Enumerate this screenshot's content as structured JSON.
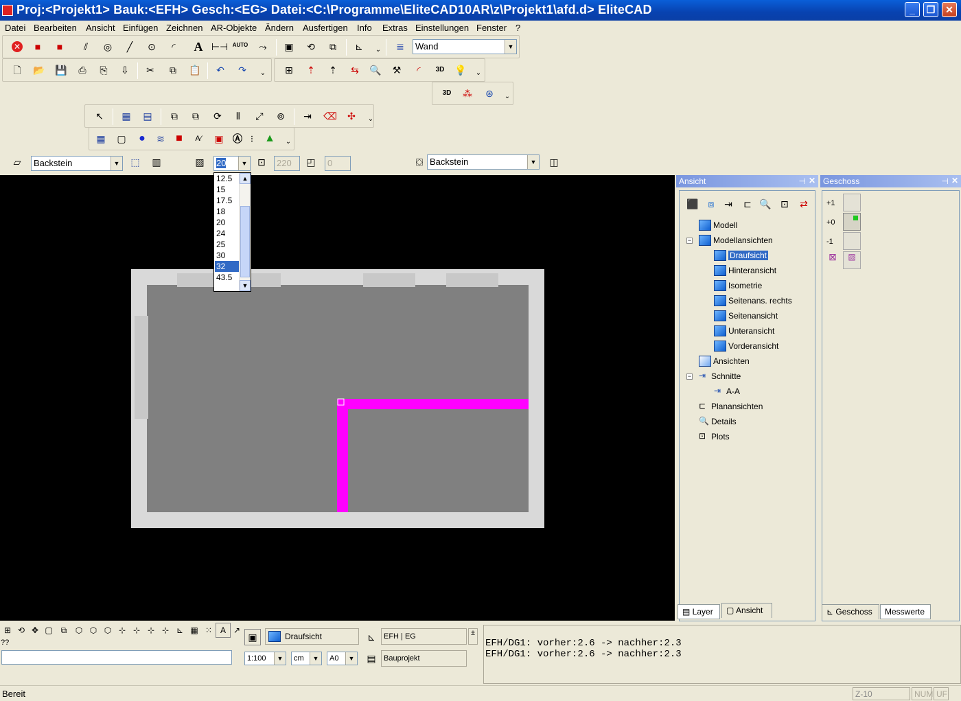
{
  "window": {
    "title": "Proj:<Projekt1> Bauk:<EFH>  Gesch:<EG>  Datei:<C:\\Programme\\EliteCAD10AR\\z\\Projekt1\\afd.d> EliteCAD",
    "minimize": "_",
    "maximize": "❐",
    "close": "✕"
  },
  "menu": [
    "Datei",
    "Bearbeiten",
    "Ansicht",
    "Einfügen",
    "Zeichnen",
    "AR-Objekte",
    "Ändern",
    "Ausfertigen",
    "Info",
    "Extras",
    "Einstellungen",
    "Fenster",
    "?"
  ],
  "toolbar1": {
    "layer_combo": "Wand",
    "auto_label": "AUTO"
  },
  "toolbar3": {
    "p3d_label": "3D"
  },
  "props": {
    "material_left": "Backstein",
    "thickness": "20",
    "height": "220",
    "offset": "0",
    "material_right": "Backstein"
  },
  "dropdown": {
    "options": [
      "12.5",
      "15",
      "17.5",
      "18",
      "20",
      "24",
      "25",
      "30",
      "32",
      "43.5"
    ],
    "selected": "32"
  },
  "ansicht_panel": {
    "title": "Ansicht",
    "tree": [
      {
        "label": "Modell"
      },
      {
        "label": "Modellansichten"
      },
      {
        "label": "Draufsicht",
        "selected": true
      },
      {
        "label": "Hinteransicht"
      },
      {
        "label": "Isometrie"
      },
      {
        "label": "Seitenans. rechts"
      },
      {
        "label": "Seitenansicht"
      },
      {
        "label": "Unteransicht"
      },
      {
        "label": "Vorderansicht"
      },
      {
        "label": "Ansichten"
      },
      {
        "label": "Schnitte"
      },
      {
        "label": "A-A"
      },
      {
        "label": "Planansichten"
      },
      {
        "label": "Details"
      },
      {
        "label": "Plots"
      }
    ],
    "tabs": [
      "Layer",
      "Ansicht"
    ]
  },
  "geschoss_panel": {
    "title": "Geschoss",
    "levels": [
      "+1",
      "+0",
      "-1"
    ],
    "tabs": [
      "Geschoss",
      "Messwerte"
    ]
  },
  "bottom": {
    "prompt": "??",
    "view_combo": "Draufsicht",
    "storey_combo": "EFH | EG",
    "project_combo": "Bauprojekt",
    "scale": "1:100",
    "unit": "cm",
    "paper": "A0",
    "plus_minus": "±"
  },
  "output": {
    "lines": [
      "EFH/DG1: vorher:2.6 -> nachher:2.3",
      "EFH/DG1: vorher:2.6 -> nachher:2.3"
    ]
  },
  "status": {
    "text": "Bereit",
    "z": "Z-10",
    "num": "NUM",
    "uf": "UF"
  },
  "colors": {
    "canvas_bg": "#000000",
    "wall_outer": "#d9d9d9",
    "floor": "#808080",
    "new_wall": "#ff00ff",
    "title_blue": "#0842b0",
    "selection": "#316ac5"
  }
}
